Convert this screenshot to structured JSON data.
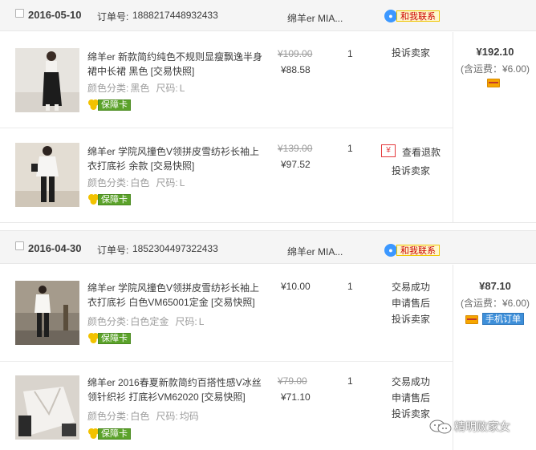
{
  "order_no_label": "订单号:",
  "contact_label": "和我联系",
  "guarantee_label": "保障卡",
  "color_label": "颜色分类:",
  "size_label": "尺码:",
  "orders": [
    {
      "date": "2016-05-10",
      "order_no": "1888217448932433",
      "shop": "绵羊er MIA...",
      "total": "¥192.10",
      "shipping": "(含运费：¥6.00)",
      "items": [
        {
          "title": "绵羊er 新款简约纯色不规则显瘦飘逸半身裙中长裙 黑色 [交易快照]",
          "color": "黑色",
          "size": "L",
          "price_old": "¥109.00",
          "price": "¥88.58",
          "qty": "1",
          "actions": [
            "投诉卖家"
          ]
        },
        {
          "title": "绵羊er 学院风撞色V领拼皮雪纺衫长袖上衣打底衫 余款 [交易快照]",
          "color": "白色",
          "size": "L",
          "price_old": "¥139.00",
          "price": "¥97.52",
          "qty": "1",
          "refund_label": "查看退款",
          "refund_icon": "¥",
          "actions": [
            "投诉卖家"
          ]
        }
      ]
    },
    {
      "date": "2016-04-30",
      "order_no": "1852304497322433",
      "shop": "绵羊er MIA...",
      "total": "¥87.10",
      "shipping": "(含运费：¥6.00)",
      "mobile_tag": "手机订单",
      "items": [
        {
          "title": "绵羊er 学院风撞色V领拼皮雪纺衫长袖上衣打底衫 白色VM65001定金 [交易快照]",
          "color": "白色定金",
          "size": "L",
          "price": "¥10.00",
          "qty": "1",
          "actions": [
            "交易成功",
            "申请售后",
            "投诉卖家"
          ]
        },
        {
          "title": "绵羊er 2016春夏新款简约百搭性感V冰丝领针织衫 打底衫VM62020 [交易快照]",
          "color": "白色",
          "size": "均码",
          "price_old": "¥79.00",
          "price": "¥71.10",
          "qty": "1",
          "actions": [
            "交易成功",
            "申请售后",
            "投诉卖家"
          ]
        }
      ]
    }
  ],
  "watermark": "精明败家女",
  "colors": {
    "header_bg": "#f5f5f5",
    "guarantee_green": "#5ba22a",
    "contact_blue": "#3c98ff",
    "mobile_blue": "#3e8fd9"
  }
}
